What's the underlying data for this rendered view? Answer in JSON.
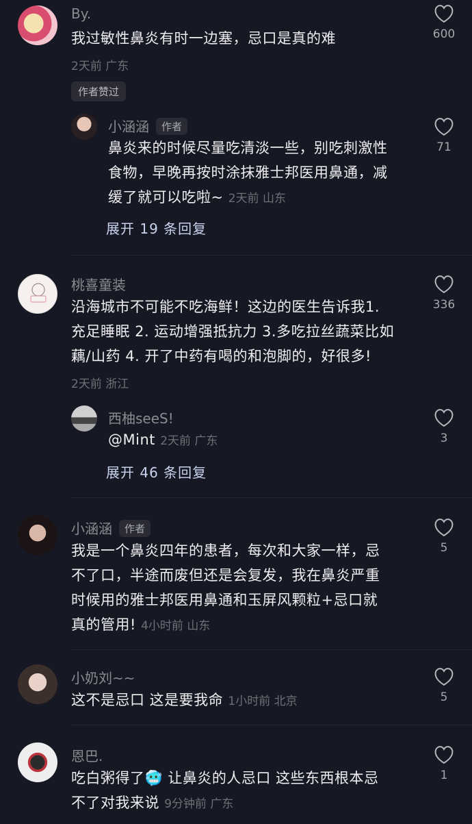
{
  "comments": [
    {
      "name": "By.",
      "text": "我过敏性鼻炎有时一边塞，忌口是真的难",
      "time": "2天前",
      "location": "广东",
      "likes": "600",
      "liked_badge": "作者赞过",
      "reply": {
        "name": "小涵涵",
        "tag": "作者",
        "text_line1": "鼻炎来的时候尽量吃清淡一些，别吃刺激性",
        "text_line2": "食物，早晚再按时涂抹雅士邦医用鼻通，减",
        "text_line3": "缓了就可以吃啦~",
        "time": "2天前",
        "location": "山东",
        "likes": "71"
      },
      "expand_label": "展开 19 条回复"
    },
    {
      "name": "桃喜童装",
      "text_line1": "沿海城市不可能不吃海鲜！这边的医生告诉我1.",
      "text_line2": "充足睡眠 2. 运动增强抵抗力 3.多吃拉丝蔬菜比如",
      "text_line3": "藕/山药 4. 开了中药有喝的和泡脚的，好很多!",
      "time": "2天前",
      "location": "浙江",
      "likes": "336",
      "reply": {
        "name": "西柚seeS!",
        "text": "@Mint",
        "time": "2天前",
        "location": "广东",
        "likes": "3"
      },
      "expand_label": "展开 46 条回复"
    },
    {
      "name": "小涵涵",
      "tag": "作者",
      "text_line1": "我是一个鼻炎四年的患者，每次和大家一样，忌",
      "text_line2": "不了口，半途而废但还是会复发，我在鼻炎严重",
      "text_line3": "时候用的雅士邦医用鼻通和玉屏风颗粒+忌口就",
      "text_line4": "真的管用!",
      "time": "4小时前",
      "location": "山东",
      "likes": "5"
    },
    {
      "name": "小奶刘~~",
      "text": "这不是忌口 这是要我命",
      "time": "1小时前",
      "location": "北京",
      "likes": "5"
    },
    {
      "name": "恩巴.",
      "text_line1": "吃白粥得了",
      "emoji": "🥶",
      "text_line1b": " 让鼻炎的人忌口 这些东西根本忌",
      "text_line2": "不了对我来说",
      "time": "9分钟前",
      "location": "广东",
      "likes": "1"
    }
  ],
  "icons": {
    "like": "heart-outline-icon"
  },
  "colors": {
    "background": "#161823",
    "expand": "#c9d3ee"
  }
}
